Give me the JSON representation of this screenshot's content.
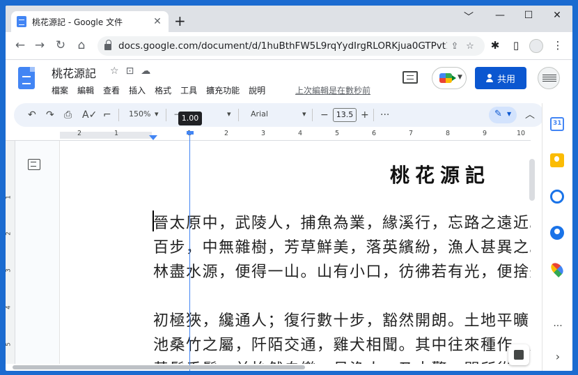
{
  "browser": {
    "tab_title": "桃花源記 - Google 文件",
    "tab_close": "✕",
    "new_tab": "+",
    "minimize": "﹀",
    "min_btn": "—",
    "max_btn": "☐",
    "close_btn": "✕",
    "url": "docs.google.com/document/d/1huBthFW5L9rqYydIrgRLORKjua0GTPvt1i..."
  },
  "docs": {
    "title": "桃花源記",
    "menu": [
      "檔案",
      "編輯",
      "查看",
      "插入",
      "格式",
      "工具",
      "擴充功能",
      "說明"
    ],
    "last_edit": "上次編輯是在數秒前",
    "share_label": "共用"
  },
  "toolbar": {
    "zoom": "150%",
    "style": "—",
    "font": "Arial",
    "font_size": "13.5",
    "minus": "−",
    "plus": "+",
    "more": "···"
  },
  "ruler": {
    "tooltip": "1.00",
    "numbers": [
      "2",
      "1",
      "1",
      "2",
      "3",
      "4",
      "5",
      "6",
      "7",
      "8",
      "9",
      "10"
    ],
    "vnumbers": [
      "1",
      "2",
      "3",
      "4",
      "5"
    ]
  },
  "document": {
    "heading": "桃花源記",
    "lines": [
      "晉太原中，武陵人，捕魚為業，緣溪行，忘路之遠近。忽逢桃花林，夾岸數",
      "百步，中無雜樹，芳草鮮美，落英繽紛，漁人甚異之。復前行，欲窮其林。",
      "林盡水源，便得一山。山有小口，彷彿若有光，便捨船，從口入。",
      "",
      "初極狹，纔通人；復行數十步，豁然開朗。土地平曠，屋舍儼然，有良田美",
      "池桑竹之屬，阡陌交通，雞犬相聞。其中往來種作，男女衣著，悉如外人。",
      "黃髮垂髫，並怡然自樂。見漁人，乃大驚，問所從來。"
    ]
  },
  "side_panel": {
    "more": "···",
    "expand": "›"
  },
  "colors": {
    "accent": "#0b57d0",
    "toolbar_bg": "#edf2fa",
    "guide": "#4285f4"
  }
}
